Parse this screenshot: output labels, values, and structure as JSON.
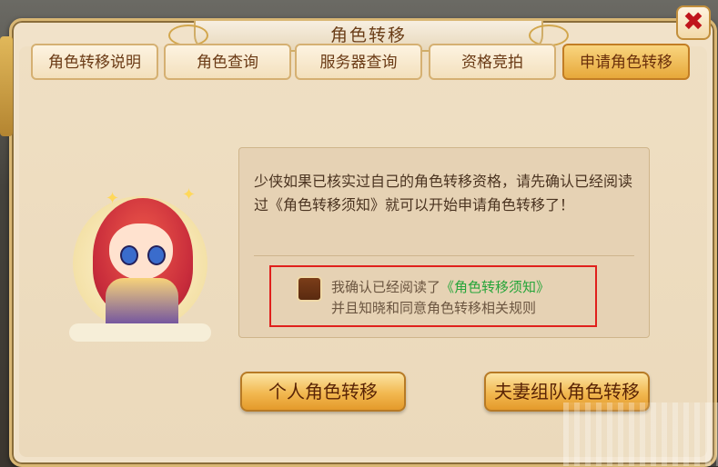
{
  "window": {
    "title": "角色转移",
    "close_symbol": "✖"
  },
  "tabs": [
    {
      "label": "角色转移说明",
      "active": false
    },
    {
      "label": "角色查询",
      "active": false
    },
    {
      "label": "服务器查询",
      "active": false
    },
    {
      "label": "资格竞拍",
      "active": false
    },
    {
      "label": "申请角色转移",
      "active": true
    }
  ],
  "info": {
    "message": "少侠如果已核实过自己的角色转移资格，请先确认已经阅读过《角色转移须知》就可以开始申请角色转移了！"
  },
  "agreement": {
    "checked": false,
    "line1_prefix": "我确认已经阅读了",
    "rules_link": "《角色转移须知》",
    "line2": "并且知晓和同意角色转移相关规则"
  },
  "buttons": {
    "personal": "个人角色转移",
    "couple_team": "夫妻组队角色转移"
  },
  "colors": {
    "panel_bg": "#f1e2c9",
    "tab_active": "#e7a83a",
    "link_green": "#27a53a",
    "highlight_red": "#e0201c",
    "close_red": "#c0141b"
  }
}
